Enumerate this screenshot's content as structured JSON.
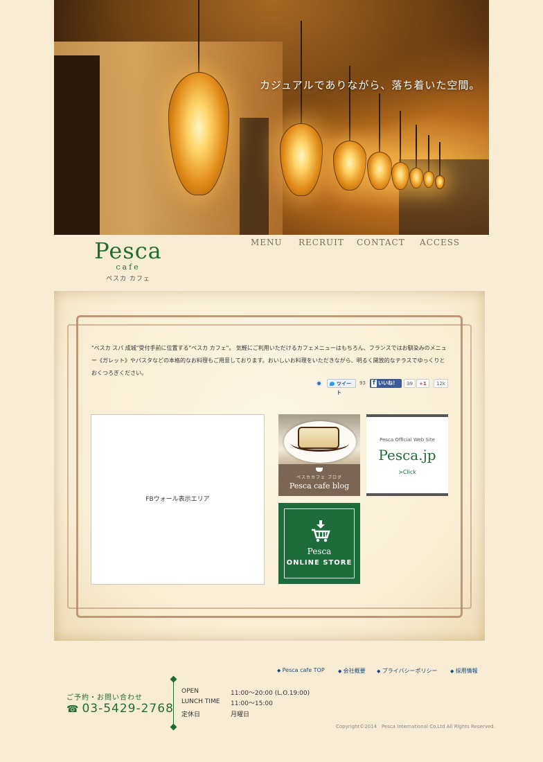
{
  "hero": {
    "caption": "カジュアルでありながら、落ち着いた空間。"
  },
  "logo": {
    "word": "Pesca",
    "sub": "cafe",
    "kana": "ペスカ カフェ"
  },
  "nav": [
    "MENU",
    "RECRUIT",
    "CONTACT",
    "ACCESS"
  ],
  "intro": {
    "text": "\"ペスカ スパ 成城\"受付手前に位置する\"ペスカ カフェ\"。 気軽にご利用いただけるカフェメニューはもちろん、フランスではお馴染みのメニュー《ガレット》やパスタなどの本格的なお料理もご用意しております。おいしいお料理をいただきながら、明るく開放的なテラスでゆっくりとおくつろぎください。"
  },
  "social": {
    "tweet_label": "ツイート",
    "tweet_count": "93",
    "like_label": "いいね！",
    "like_count": "39",
    "plus_label": "+1",
    "plus_count": "12k"
  },
  "fbwall": {
    "label": "FBウォール表示エリア"
  },
  "blog": {
    "jp": "ペスカカフェ ブログ",
    "en": "Pesca cafe blog"
  },
  "official": {
    "line1": "Pesca Official Web Site",
    "line2": "Pesca.jp",
    "line3": ">Click"
  },
  "store": {
    "line1": "Pesca",
    "line2": "ONLINE STORE"
  },
  "footer": {
    "links": [
      "Pesca cafe TOP",
      "会社概要",
      "プライバシーポリシー",
      "採用情報"
    ],
    "contact_heading": "ご予約・お問い合わせ",
    "phone": "03-5429-2768",
    "hours": [
      {
        "label": "OPEN",
        "value": "11:00～20:00 (L.O.19:00)"
      },
      {
        "label": "LUNCH TIME",
        "value": "11:00～15:00"
      },
      {
        "label": "定休日",
        "value": "月曜日"
      }
    ],
    "copyright": "Copyright©2014　Pesca International Co.Ltd All Rights Reserved."
  },
  "colors": {
    "background": "#f8ecd4",
    "brand_green": "#1f6b3a",
    "link_blue": "#1a4a7a",
    "blog_brown": "#7b6656"
  }
}
